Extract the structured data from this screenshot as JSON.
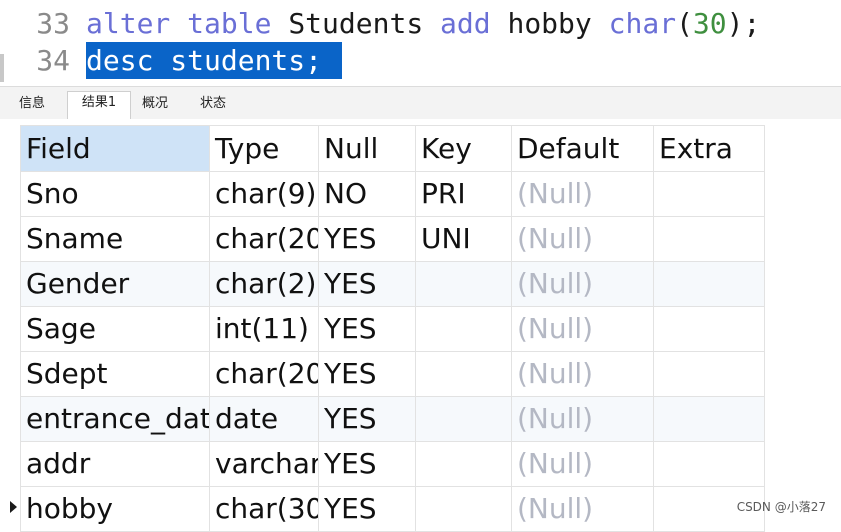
{
  "editor": {
    "lines": [
      {
        "number": "33",
        "tokens": {
          "alter": "alter",
          "table": "table",
          "name": "Students",
          "add": "add",
          "column": "hobby",
          "type": "char",
          "open": "(",
          "size": "30",
          "close": ");"
        }
      },
      {
        "number": "34",
        "text": "desc students;"
      }
    ]
  },
  "tabs": [
    {
      "label": "信息",
      "active": false
    },
    {
      "label": "结果1",
      "active": true
    },
    {
      "label": "概况",
      "active": false
    },
    {
      "label": "状态",
      "active": false
    }
  ],
  "result": {
    "columns": [
      "Field",
      "Type",
      "Null",
      "Key",
      "Default",
      "Extra"
    ],
    "rows": [
      [
        "Sno",
        "char(9)",
        "NO",
        "PRI",
        "(Null)",
        ""
      ],
      [
        "Sname",
        "char(20",
        "YES",
        "UNI",
        "(Null)",
        ""
      ],
      [
        "Gender",
        "char(2)",
        "YES",
        "",
        "(Null)",
        ""
      ],
      [
        "Sage",
        "int(11)",
        "YES",
        "",
        "(Null)",
        ""
      ],
      [
        "Sdept",
        "char(20",
        "YES",
        "",
        "(Null)",
        ""
      ],
      [
        "entrance_dat",
        "date",
        "YES",
        "",
        "(Null)",
        ""
      ],
      [
        "addr",
        "varchar",
        "YES",
        "",
        "(Null)",
        ""
      ],
      [
        "hobby",
        "char(30",
        "YES",
        "",
        "(Null)",
        ""
      ]
    ]
  },
  "watermark": "CSDN @小落27",
  "colors": {
    "keyword": "#6a6fd6",
    "number": "#3f8f3f",
    "selection": "#0a64c8",
    "null_text": "#b4b8c4",
    "sorted_header": "#cfe3f7"
  }
}
